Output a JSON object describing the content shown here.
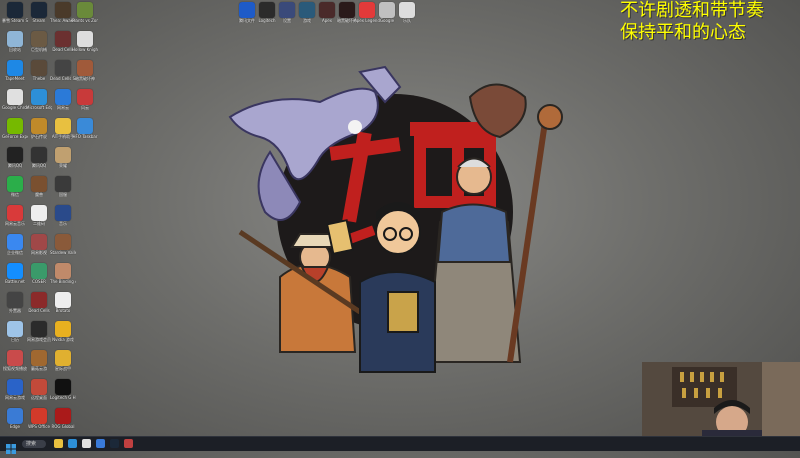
{
  "overlay": {
    "line1": "不许剧透和带节奏",
    "line2": "保持平和的心态"
  },
  "desktop_columns": [
    {
      "x": 2,
      "icons": [
        {
          "name": "steam-icon",
          "label": "暴雪 Steam Store",
          "color": "#1b2838"
        },
        {
          "name": "recycle-bin-icon",
          "label": "回收站",
          "color": "#8fb5d6"
        },
        {
          "name": "chat-app-icon",
          "label": "TapeMeet",
          "color": "#1e88e5"
        },
        {
          "name": "chrome-icon",
          "label": "Google Chrome",
          "color": "#e0e0e0"
        },
        {
          "name": "nvidia-icon",
          "label": "GeForce Experience",
          "color": "#76b900"
        },
        {
          "name": "qq-icon",
          "label": "腾讯QQ",
          "color": "#222"
        },
        {
          "name": "wechat-icon",
          "label": "微信",
          "color": "#2bae4a"
        },
        {
          "name": "netease-music-icon",
          "label": "网易云音乐",
          "color": "#d93a3a"
        },
        {
          "name": "lark-icon",
          "label": "企业微信",
          "color": "#3a88f0"
        },
        {
          "name": "battlenet-icon",
          "label": "Battle.net",
          "color": "#148eff"
        },
        {
          "name": "game-icon",
          "label": "外置器",
          "color": "#444"
        },
        {
          "name": "folder-icon",
          "label": "日历",
          "color": "#9ec4e8"
        },
        {
          "name": "photo-app-icon",
          "label": "搜狐视频播放",
          "color": "#c94b4b"
        },
        {
          "name": "connect-icon",
          "label": "网易云游戏",
          "color": "#2a63c8"
        },
        {
          "name": "globe-icon",
          "label": "Edge",
          "color": "#3a7bd5"
        }
      ]
    },
    {
      "x": 28,
      "icons": [
        {
          "name": "steam-icon",
          "label": "Steam",
          "color": "#1b2838"
        },
        {
          "name": "character-icon",
          "label": "巨型机械",
          "color": "#6b5a44"
        },
        {
          "name": "character-icon",
          "label": "Thebe",
          "color": "#5a4a3a"
        },
        {
          "name": "edge-icon",
          "label": "Microsoft Edge",
          "color": "#2d8fd8"
        },
        {
          "name": "app-icon",
          "label": "炉石传说",
          "color": "#c08a2a"
        },
        {
          "name": "qq-icon",
          "label": "腾讯QQ",
          "color": "#333"
        },
        {
          "name": "game-icon",
          "label": "魔兽",
          "color": "#7a5030"
        },
        {
          "name": "qr-icon",
          "label": "二维码",
          "color": "#eee"
        },
        {
          "name": "gift-icon",
          "label": "网易影视",
          "color": "#a04848"
        },
        {
          "name": "app-icon",
          "label": "COSER",
          "color": "#3a9a6a"
        },
        {
          "name": "shield-icon",
          "label": "Dead Cells",
          "color": "#8b2a2a"
        },
        {
          "name": "app-icon",
          "label": "网易游戏会员",
          "color": "#2b2b2b"
        },
        {
          "name": "character-icon",
          "label": "蘑菇云游",
          "color": "#a06830"
        },
        {
          "name": "app-icon",
          "label": "远程桌面",
          "color": "#c24a3a"
        },
        {
          "name": "wps-icon",
          "label": "WPS Office",
          "color": "#d23a2a"
        }
      ]
    },
    {
      "x": 50,
      "icons": [
        {
          "name": "game-icon",
          "label": "Thea: Awakening",
          "color": "#4a3a2a"
        },
        {
          "name": "game-icon",
          "label": "Dead Cells",
          "color": "#6b3030"
        },
        {
          "name": "game-icon",
          "label": "Dead Cells Soundtrack",
          "color": "#444"
        },
        {
          "name": "app-icon",
          "label": "网易云",
          "color": "#2b7ad8"
        },
        {
          "name": "folder-icon",
          "label": "AIT手柄助手",
          "color": "#e8c040"
        },
        {
          "name": "character-icon",
          "label": "荣耀",
          "color": "#c0a070"
        },
        {
          "name": "app-icon",
          "label": "国服",
          "color": "#3a3a3a"
        },
        {
          "name": "music-icon",
          "label": "音乐",
          "color": "#2a4a8a"
        },
        {
          "name": "character-icon",
          "label": "Stardew Valley",
          "color": "#8a5a3a"
        },
        {
          "name": "character-icon",
          "label": "The Binding of Isaac",
          "color": "#c08a6a"
        },
        {
          "name": "skull-icon",
          "label": "Brotato",
          "color": "#eee"
        },
        {
          "name": "app-icon",
          "label": "Nvidia 游戏",
          "color": "#e8b020"
        },
        {
          "name": "game-icon",
          "label": "星际战甲",
          "color": "#e0b030"
        },
        {
          "name": "logitech-icon",
          "label": "Logitech G HUB",
          "color": "#111"
        },
        {
          "name": "app-icon",
          "label": "ROG Global",
          "color": "#aa1a1a"
        }
      ]
    },
    {
      "x": 72,
      "icons": [
        {
          "name": "game-icon",
          "label": "Plants vs Zombies",
          "color": "#6a8a3a"
        },
        {
          "name": "character-icon",
          "label": "Hollow Knight",
          "color": "#ddd"
        },
        {
          "name": "character-icon",
          "label": "暗黑破坏神",
          "color": "#a05a3a"
        },
        {
          "name": "app-icon",
          "label": "风云",
          "color": "#c83a3a"
        },
        {
          "name": "app-icon",
          "label": "HFO Taskbar",
          "color": "#3a8ad8"
        }
      ]
    }
  ],
  "top_icons": [
    {
      "name": "ps-app-icon",
      "label": "腾讯文件",
      "color": "#1e5bc8"
    },
    {
      "name": "app-icon",
      "label": "Logitech",
      "color": "#2b2b2b"
    },
    {
      "name": "app-icon",
      "label": "设置",
      "color": "#3a4a7a"
    },
    {
      "name": "game-icon",
      "label": "游戏",
      "color": "#2a5a7a"
    },
    {
      "name": "app-icon",
      "label": "Apex",
      "color": "#4a2a2a"
    },
    {
      "name": "game-icon",
      "label": "暗黑破坏神",
      "color": "#2a1a1a"
    },
    {
      "name": "app-icon",
      "label": "Apex Legends",
      "color": "#e23a3a"
    },
    {
      "name": "app-icon",
      "label": "Google",
      "color": "#c0c0c0"
    },
    {
      "name": "app-icon",
      "label": "乐队",
      "color": "#ddd"
    }
  ],
  "taskbar": {
    "search_placeholder": "搜索",
    "apps": [
      {
        "name": "file-explorer-icon",
        "color": "#e8c040"
      },
      {
        "name": "edge-icon",
        "color": "#2d8fd8"
      },
      {
        "name": "chrome-icon",
        "color": "#e0e0e0"
      },
      {
        "name": "store-icon",
        "color": "#3a7ad8"
      },
      {
        "name": "steam-icon",
        "color": "#1b2838"
      },
      {
        "name": "app-icon",
        "color": "#c04040"
      }
    ]
  }
}
